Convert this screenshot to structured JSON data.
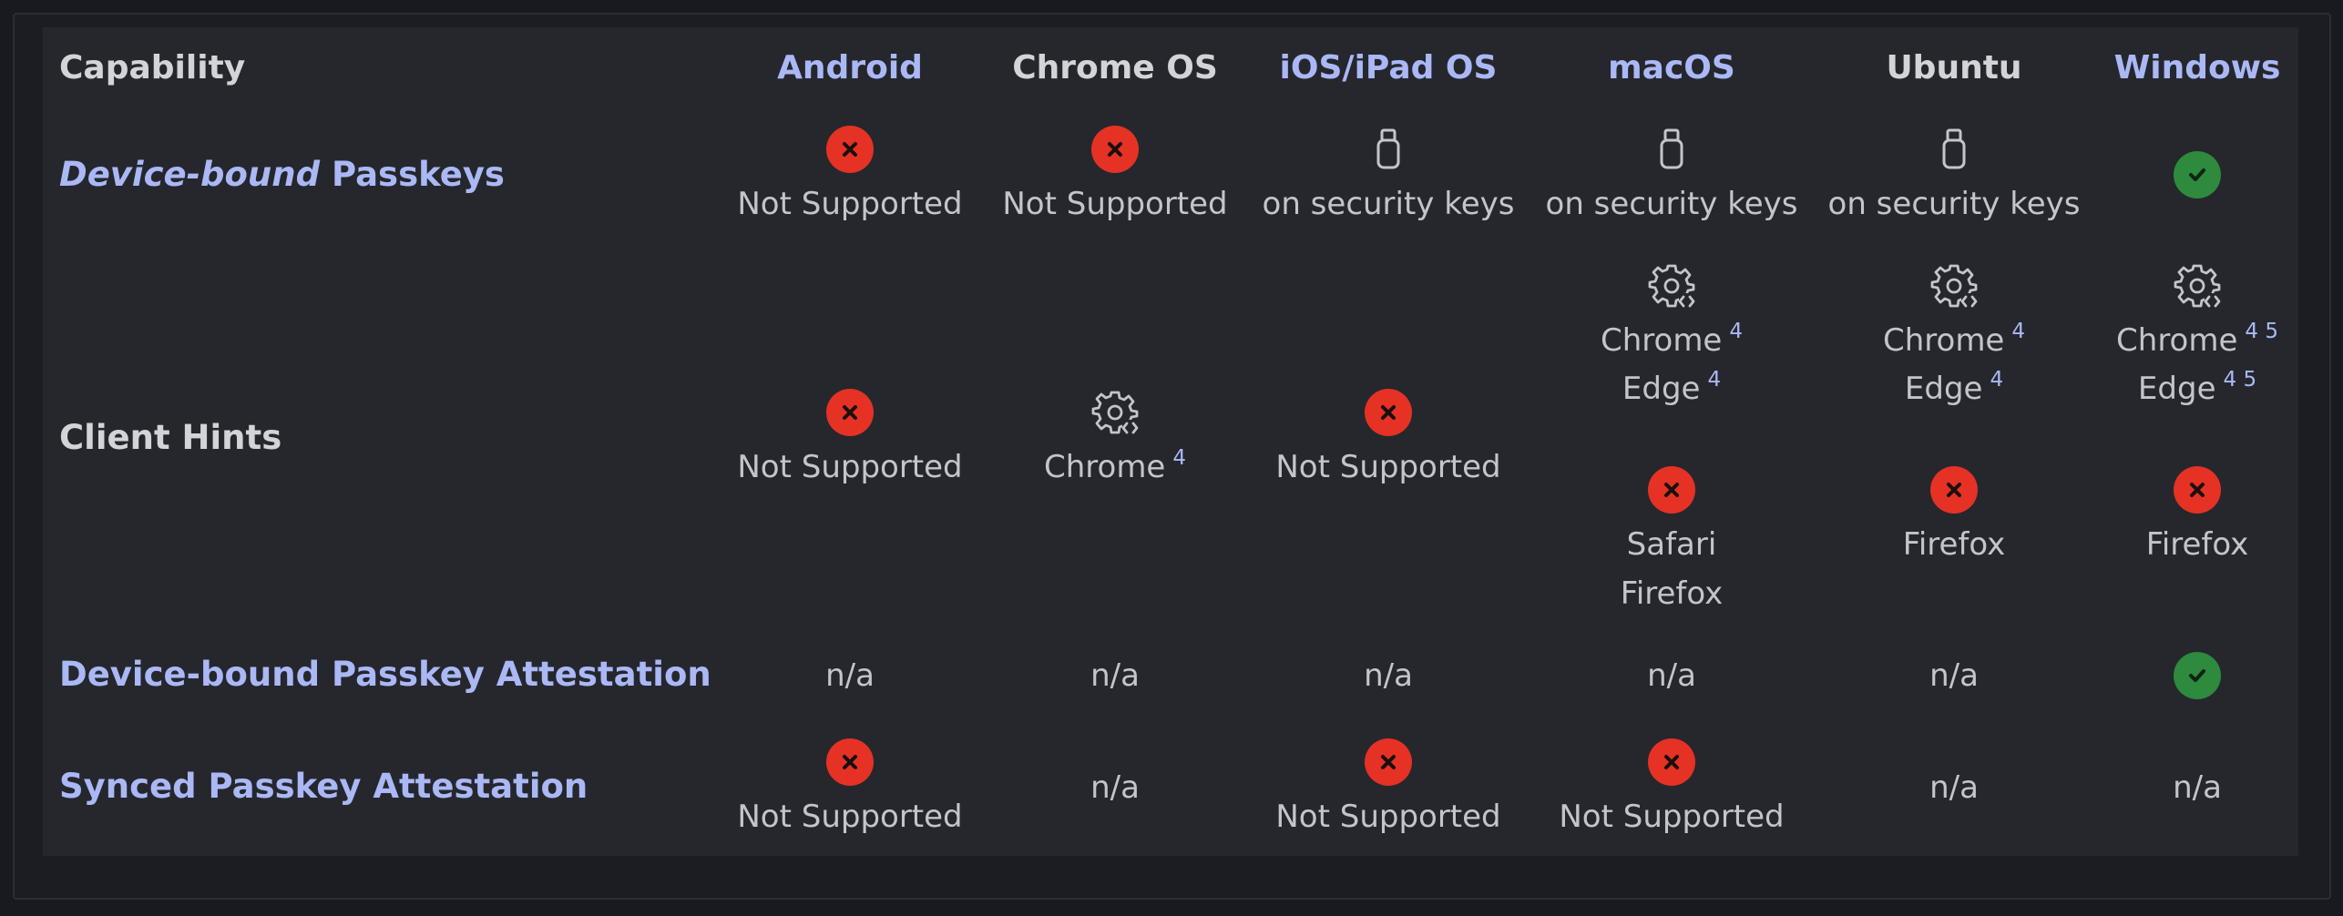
{
  "header": {
    "capability": "Capability",
    "platforms": [
      "Android",
      "Chrome OS",
      "iOS/iPad OS",
      "macOS",
      "Ubuntu",
      "Windows"
    ]
  },
  "rows": {
    "device_bound": {
      "label_em": "Device-bound",
      "label_rest": "Passkeys"
    },
    "client_hints": {
      "label": "Client Hints"
    },
    "attestation_device": {
      "label": "Device-bound Passkey Attestation"
    },
    "attestation_synced": {
      "label": "Synced Passkey Attestation"
    }
  },
  "text": {
    "not_supported": "Not Supported",
    "security_keys": "on security keys",
    "na": "n/a",
    "chrome": "Chrome",
    "edge": "Edge",
    "safari": "Safari",
    "firefox": "Firefox"
  },
  "footnotes": {
    "f4": "4",
    "f45": "4 5"
  },
  "icons": {
    "unsupported": "x-circle-icon",
    "supported": "check-circle-icon",
    "security_key": "usb-key-icon",
    "browser_setting": "settings-code-icon"
  },
  "colors": {
    "unsupported": "#e53224",
    "supported": "#2e8a3c",
    "link": "#aab8f5"
  }
}
